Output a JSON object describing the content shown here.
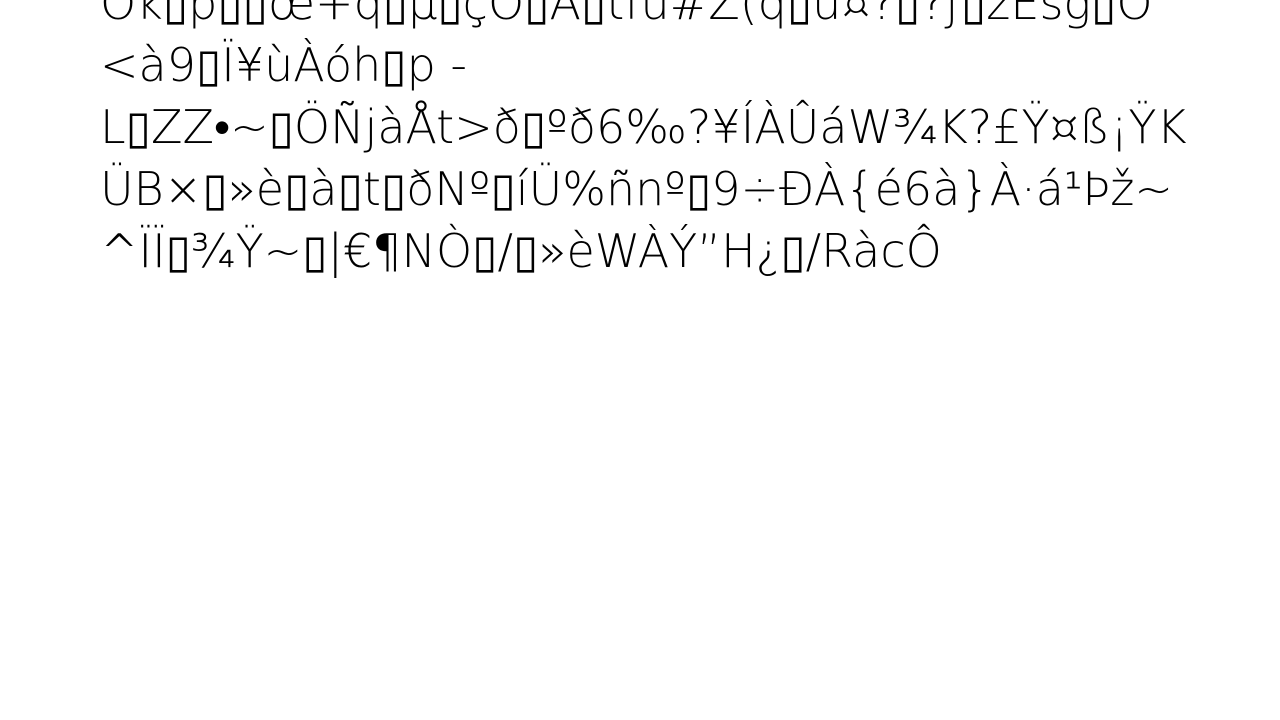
{
  "document": {
    "lines": [
      "Ok▯p▯▯œ+q▯µ▯çO▯A▯tfu#Z(q▯u¤?▯?ƒ▯zEsg▯O",
      "<à9▯Ï¥ùÀóh▯p   -",
      "L▯ZZ•~▯ÖÑjàÅt>ð▯ºð6‰?¥ÍÀÛáW¾K?£Ÿ¤ß¡ŸK",
      "ÜB×▯»è▯à▯t▯ðNº▯íÜ%ñnº▯9÷ÐÀ{é6à}À·á¹Þž~",
      "^ÏÏ▯¾Ÿ~▯|€¶NÒ▯/▯»èWÀÝ”H¿▯/RàcÔ"
    ]
  },
  "colors": {
    "background": "#ffffff",
    "text": "#000000"
  }
}
